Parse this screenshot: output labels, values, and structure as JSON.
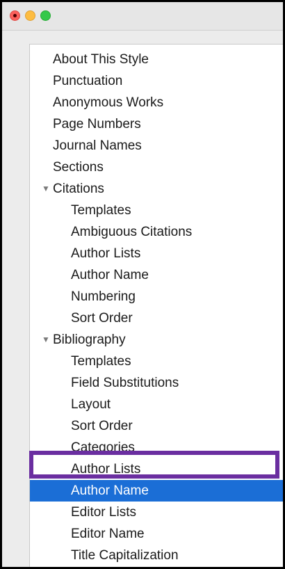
{
  "window": {
    "controls": [
      "close",
      "minimize",
      "zoom"
    ]
  },
  "sidebar": {
    "items": [
      {
        "label": "About This Style",
        "level": 1
      },
      {
        "label": "Punctuation",
        "level": 1
      },
      {
        "label": "Anonymous Works",
        "level": 1
      },
      {
        "label": "Page Numbers",
        "level": 1
      },
      {
        "label": "Journal Names",
        "level": 1
      },
      {
        "label": "Sections",
        "level": 1
      },
      {
        "label": "Citations",
        "level": 0,
        "expanded": true
      },
      {
        "label": "Templates",
        "level": 2
      },
      {
        "label": "Ambiguous Citations",
        "level": 2
      },
      {
        "label": "Author Lists",
        "level": 2
      },
      {
        "label": "Author Name",
        "level": 2
      },
      {
        "label": "Numbering",
        "level": 2
      },
      {
        "label": "Sort Order",
        "level": 2
      },
      {
        "label": "Bibliography",
        "level": 0,
        "expanded": true
      },
      {
        "label": "Templates",
        "level": 2
      },
      {
        "label": "Field Substitutions",
        "level": 2
      },
      {
        "label": "Layout",
        "level": 2
      },
      {
        "label": "Sort Order",
        "level": 2
      },
      {
        "label": "Categories",
        "level": 2
      },
      {
        "label": "Author Lists",
        "level": 2,
        "highlighted": true
      },
      {
        "label": "Author Name",
        "level": 2,
        "selected": true
      },
      {
        "label": "Editor Lists",
        "level": 2
      },
      {
        "label": "Editor Name",
        "level": 2
      },
      {
        "label": "Title Capitalization",
        "level": 2
      }
    ]
  },
  "colors": {
    "selection": "#1b6ed6",
    "highlight_border": "#6a2ea0"
  }
}
